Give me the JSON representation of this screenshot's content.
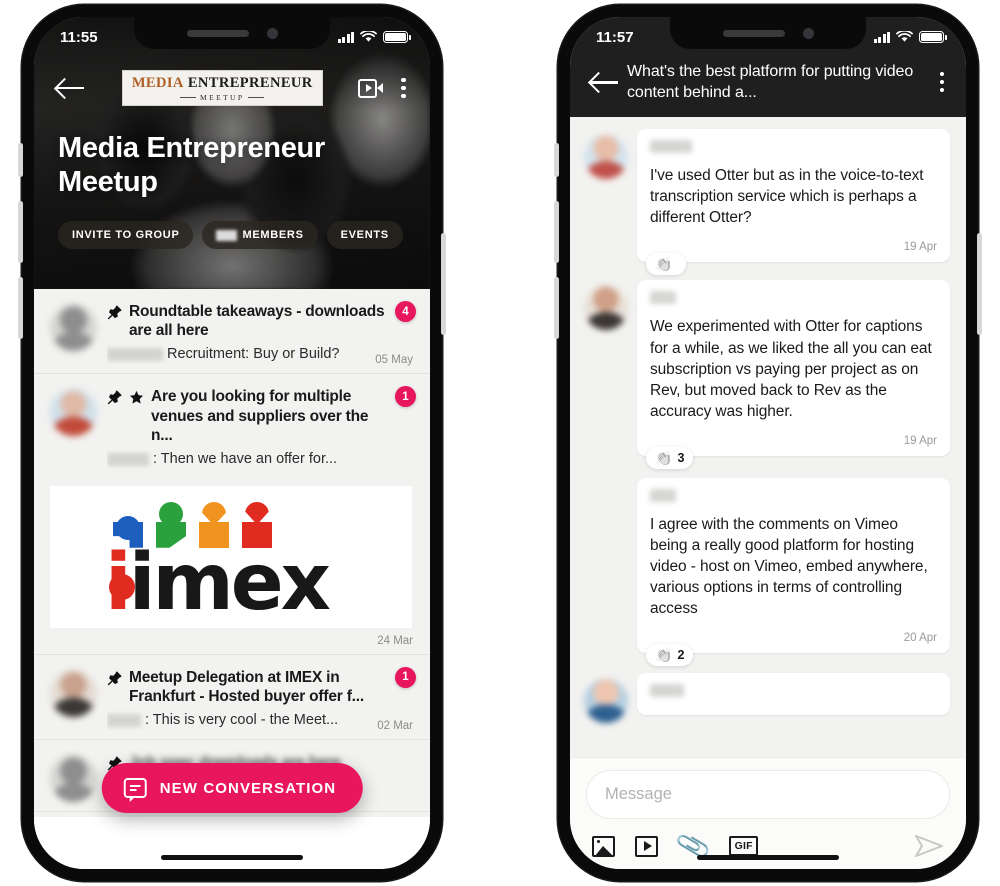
{
  "left_phone": {
    "status_bar": {
      "time": "11:55",
      "signal_icon": "signal-bars-icon",
      "wifi_icon": "wifi-icon",
      "battery_icon": "battery-icon"
    },
    "header": {
      "back_icon": "back-arrow-icon",
      "logo": {
        "word1": "MEDIA",
        "word2": "ENTREPRENEUR",
        "subtitle": "MEETUP",
        "word1_color": "#b05f23",
        "word2_color": "#1c1c1c"
      },
      "video_icon": "video-camera-icon",
      "menu_icon": "kebab-menu-icon"
    },
    "group_title": "Media Entrepreneur Meetup",
    "chips": [
      {
        "label": "INVITE TO GROUP",
        "has_count": false
      },
      {
        "label": "MEMBERS",
        "has_count": true
      },
      {
        "label": "EVENTS",
        "has_count": false
      }
    ],
    "conversations": [
      {
        "title": "Roundtable takeaways - downloads are all here",
        "preview": "Recruitment: Buy or Build?",
        "date": "05 May",
        "badge": "4",
        "pinned": true,
        "starred": false,
        "name_blur_width": 56,
        "avatar_class": "",
        "has_image": false
      },
      {
        "title": "Are you looking for multiple venues and suppliers over the n...",
        "preview": ": Then we have an offer for...",
        "date": "24 Mar",
        "badge": "1",
        "pinned": true,
        "starred": true,
        "name_blur_width": 42,
        "avatar_class": "color1",
        "has_image": true,
        "image_alt": "imex-logo"
      },
      {
        "title": "Meetup Delegation at IMEX in Frankfurt - Hosted buyer offer f...",
        "preview": ": This is very cool - the Meet...",
        "date": "02 Mar",
        "badge": "1",
        "pinned": true,
        "starred": false,
        "name_blur_width": 34,
        "avatar_class": "color2",
        "has_image": false
      }
    ],
    "fab": {
      "label": "NEW CONVERSATION",
      "icon": "chat-bubble-icon",
      "color": "#e8175d"
    }
  },
  "right_phone": {
    "status_bar": {
      "time": "11:57",
      "signal_icon": "signal-bars-icon",
      "wifi_icon": "wifi-icon",
      "battery_icon": "battery-icon"
    },
    "header": {
      "back_icon": "back-arrow-icon",
      "title": "What's the best platform for putting video content behind a...",
      "menu_icon": "kebab-menu-icon"
    },
    "messages": [
      {
        "text": "I've used Otter but as in the voice-to-text transcription service which is perhaps a different Otter?",
        "date": "19 Apr",
        "reaction_emoji": "👏",
        "reaction_count": "",
        "name_blur_width": 42,
        "avatar_class": "av-a"
      },
      {
        "text": "We experimented with Otter for captions for a while, as we liked the all you can eat subscription vs paying per project as on Rev, but moved back to Rev as the accuracy was higher.",
        "date": "19 Apr",
        "reaction_emoji": "👏",
        "reaction_count": "3",
        "name_blur_width": 26,
        "avatar_class": "av-b"
      },
      {
        "text": "I agree with the comments on Vimeo being a really good platform for hosting video - host on Vimeo, embed anywhere, various options in terms of controlling access",
        "date": "20 Apr",
        "reaction_emoji": "👏",
        "reaction_count": "2",
        "name_blur_width": 26,
        "avatar_class": "",
        "indented": true
      },
      {
        "text": "",
        "date": "",
        "reaction_emoji": "",
        "reaction_count": "",
        "name_blur_width": 34,
        "avatar_class": "av-c",
        "cut_off": true
      }
    ],
    "composer": {
      "placeholder": "Message",
      "value": "",
      "tools": [
        {
          "name": "image-icon",
          "label": ""
        },
        {
          "name": "video-icon",
          "label": ""
        },
        {
          "name": "attachment-icon",
          "label": ""
        },
        {
          "name": "gif-icon",
          "label": "GIF"
        }
      ],
      "send_icon": "send-icon"
    }
  },
  "theme": {
    "accent": "#e8175d",
    "list_bg": "#f2f2f0",
    "header_dark": "#1f1f1f"
  }
}
